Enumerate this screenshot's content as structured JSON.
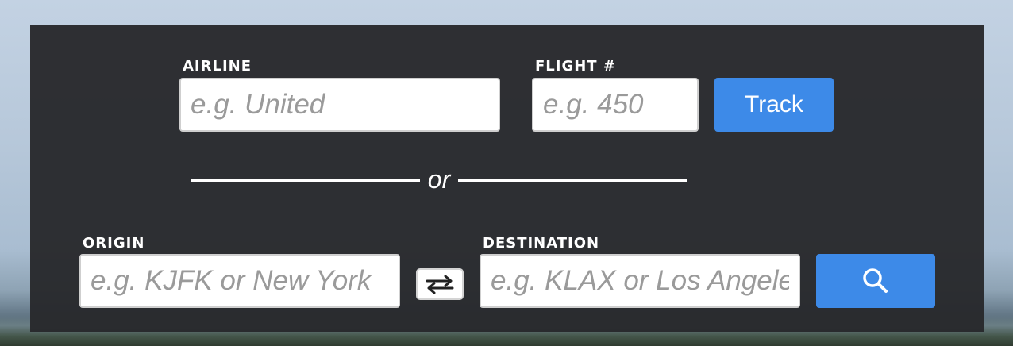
{
  "flight_search": {
    "airline_label": "AIRLINE",
    "airline_placeholder": "e.g. United",
    "flight_label": "FLIGHT #",
    "flight_placeholder": "e.g. 450",
    "track_label": "Track",
    "or_text": "or"
  },
  "route_search": {
    "origin_label": "ORIGIN",
    "origin_placeholder": "e.g. KJFK or New York",
    "destination_label": "DESTINATION",
    "destination_placeholder": "e.g. KLAX or Los Angeles",
    "swap_icon": "swap-arrows-icon",
    "search_icon": "magnifier-icon"
  },
  "colors": {
    "panel": "#28292c",
    "accent": "#3d8ae8",
    "label_text": "#ffffff",
    "placeholder": "#9a9a9a"
  }
}
